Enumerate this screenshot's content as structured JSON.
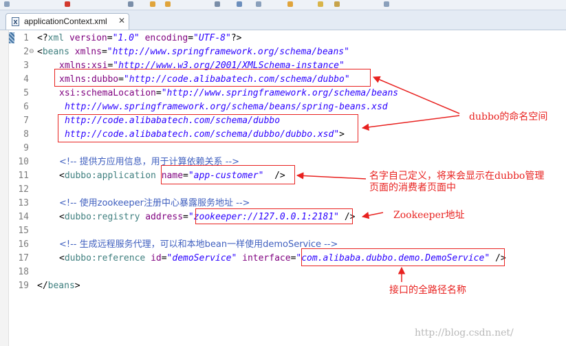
{
  "editor_tab": {
    "label": "applicationContext.xml",
    "icon": "xml-file-icon",
    "close_glyph": "✕"
  },
  "code_lines": [
    {
      "number": "1"
    },
    {
      "number": "2"
    },
    {
      "number": "3"
    },
    {
      "number": "4"
    },
    {
      "number": "5"
    },
    {
      "number": "6"
    },
    {
      "number": "7"
    },
    {
      "number": "8"
    },
    {
      "number": "9"
    },
    {
      "number": "10"
    },
    {
      "number": "11"
    },
    {
      "number": "12"
    },
    {
      "number": "13"
    },
    {
      "number": "14"
    },
    {
      "number": "15"
    },
    {
      "number": "16"
    },
    {
      "number": "17"
    },
    {
      "number": "18"
    },
    {
      "number": "19"
    }
  ],
  "code": {
    "l1": {
      "open": "<?",
      "tag": "xml",
      "a1": "version",
      "eq": "=",
      "v1": "\"1.0\"",
      "a2": "encoding",
      "v2": "\"UTF-8\"",
      "close": "?>"
    },
    "l2": {
      "open": "<",
      "tag": "beans",
      "a1": "xmlns",
      "v1": "\"http://www.springframework.org/schema/beans\""
    },
    "l3": {
      "a1": "xmlns:xsi",
      "v1": "\"http://www.w3.org/2001/XMLSchema-instance\""
    },
    "l4": {
      "a1": "xmlns:dubbo",
      "v1": "\"http://code.alibabatech.com/schema/dubbo\""
    },
    "l5": {
      "a1": "xsi:schemaLocation",
      "v1": "\"http://www.springframework.org/schema/beans"
    },
    "l6": {
      "v1": "http://www.springframework.org/schema/beans/spring-beans.xsd"
    },
    "l7": {
      "v1": "http://code.alibabatech.com/schema/dubbo"
    },
    "l8": {
      "v1": "http://code.alibabatech.com/schema/dubbo/dubbo.xsd\"",
      "close": ">"
    },
    "l10": {
      "comment": "<!-- 提供方应用信息，用于计算依赖关系 -->"
    },
    "l11": {
      "open": "<",
      "tag": "dubbo:application",
      "a1": "name",
      "v1": "\"app-customer\"",
      "close": "/>"
    },
    "l13": {
      "comment": "<!-- 使用zookeeper注册中心暴露服务地址 -->"
    },
    "l14": {
      "open": "<",
      "tag": "dubbo:registry",
      "a1": "address",
      "v1": "\"zookeeper://127.0.0.1:2181\"",
      "close": "/>"
    },
    "l16": {
      "comment": "<!-- 生成远程服务代理，可以和本地bean一样使用demoService -->"
    },
    "l17": {
      "open": "<",
      "tag": "dubbo:reference",
      "a1": "id",
      "v1": "\"demoService\"",
      "a2": "interface",
      "v2": "\"com.alibaba.dubbo.demo.DemoService\"",
      "close": "/>"
    },
    "l19": {
      "open": "</",
      "tag": "beans",
      "close": ">"
    }
  },
  "annotations": {
    "namespace": "dubbo的命名空间",
    "app_name_line1": "名字自己定义，将来会显示在dubbo管理",
    "app_name_line2": "页面的消费者页面中",
    "zookeeper": "Zookeeper地址",
    "interface": "接口的全路径名称"
  },
  "watermark": "http://blog.csdn.net/",
  "colors": {
    "annotation": "#e8211f",
    "tag": "#3f7f7f",
    "attribute": "#7f007f",
    "value": "#2a00ff",
    "comment": "#3f5fbf",
    "line_number": "#7d7d7d"
  }
}
